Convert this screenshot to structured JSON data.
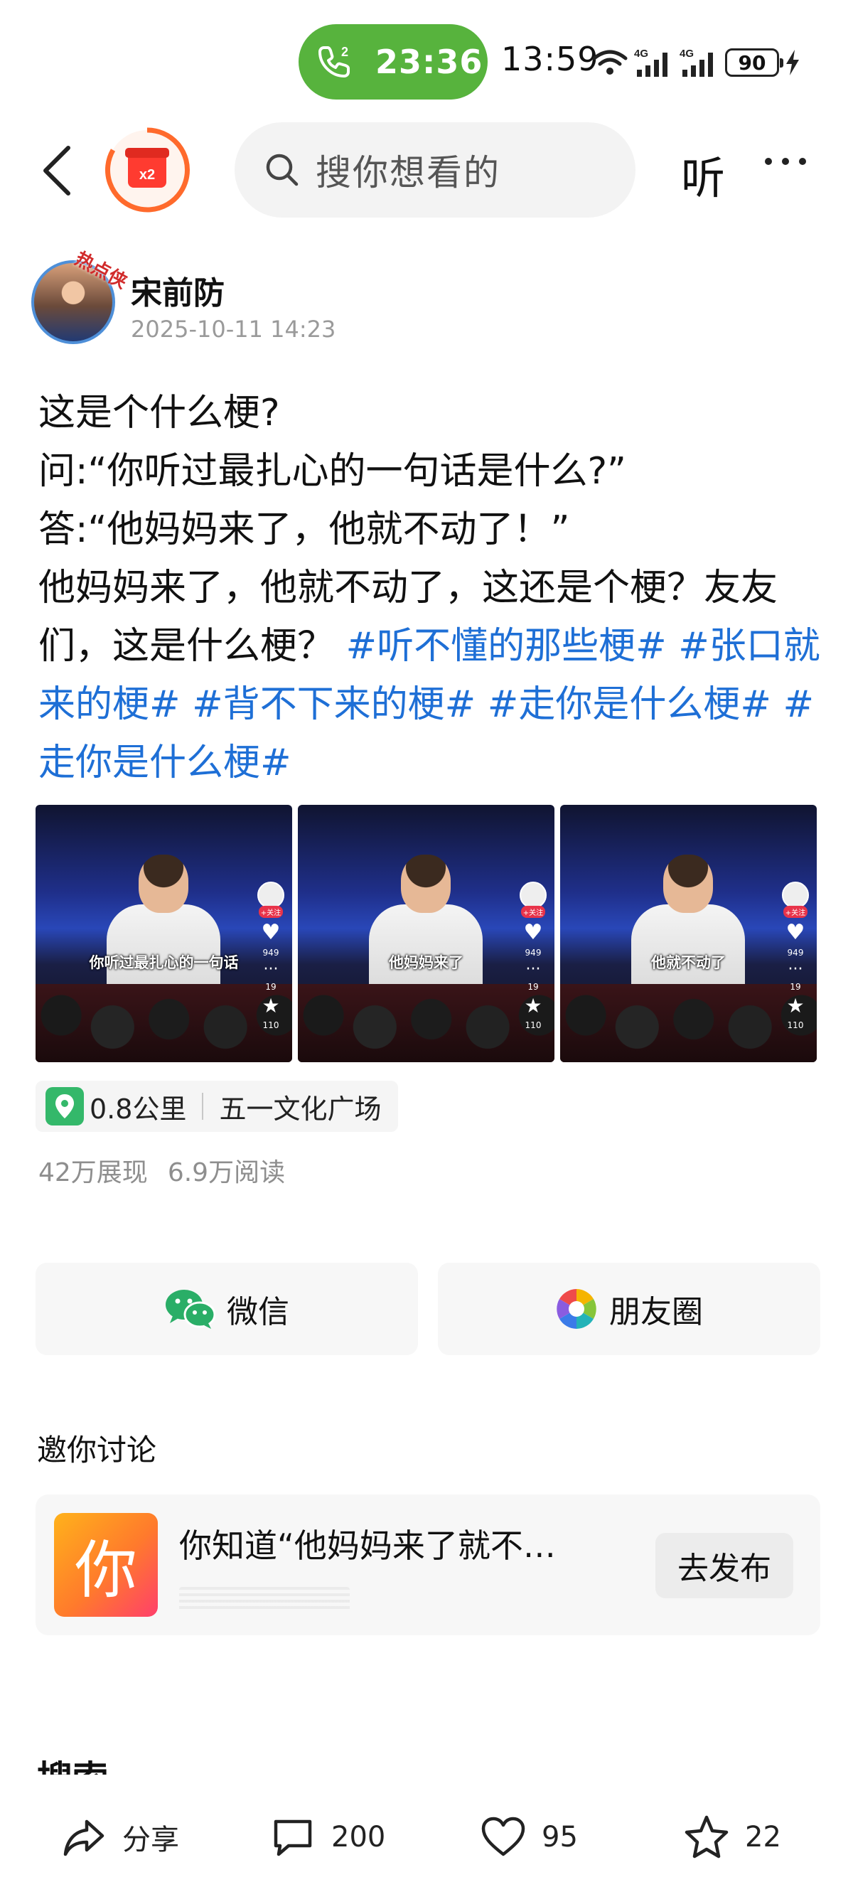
{
  "status_bar": {
    "call_time": "23:36",
    "sim_label": "2",
    "time": "13:59",
    "network_1": "4G",
    "network_2": "4G",
    "battery": "90"
  },
  "nav": {
    "badge_label": "x2",
    "search_placeholder": "搜你想看的",
    "listen_label": "听"
  },
  "author": {
    "name": "宋前防",
    "avatar_tag": "热点侠",
    "post_time": "2025-10-11 14:23"
  },
  "post": {
    "line1": "这是个什么梗?",
    "line2": "问:“你听过最扎心的一句话是什么?”",
    "line3": "答:“他妈妈来了，他就不动了！”",
    "line4_text": "他妈妈来了，他就不动了，这还是个梗？友友们，这是什么梗？",
    "tags": [
      "#听不懂的那些梗#",
      "#张口就来的梗#",
      "#背不下来的梗#",
      "#走你是什么梗#",
      "#走你是什么梗#"
    ]
  },
  "images": [
    {
      "caption": "你听过最扎心的一句话",
      "follow": "+关注",
      "likes": "949",
      "comments": "19",
      "favs": "110"
    },
    {
      "caption": "他妈妈来了",
      "follow": "+关注",
      "likes": "949",
      "comments": "19",
      "favs": "110"
    },
    {
      "caption": "他就不动了",
      "follow": "+关注",
      "likes": "949",
      "comments": "19",
      "favs": "110"
    }
  ],
  "location": {
    "distance": "0.8公里",
    "place": "五一文化广场"
  },
  "stats": {
    "impressions": "42万展现",
    "reads": "6.9万阅读"
  },
  "share": {
    "wechat": "微信",
    "moments": "朋友圈"
  },
  "discussion": {
    "title": "邀你讨论",
    "icon_char": "你",
    "question": "你知道“他妈妈来了就不…",
    "button": "去发布"
  },
  "next_section_heading": "搜索",
  "bottom_bar": {
    "share_label": "分享",
    "comments": "200",
    "likes": "95",
    "favorites": "22"
  },
  "colors": {
    "call_green": "#57b33d",
    "link_blue": "#1e6fd6",
    "location_green": "#34b86a",
    "wechat_green": "#2aae67"
  }
}
